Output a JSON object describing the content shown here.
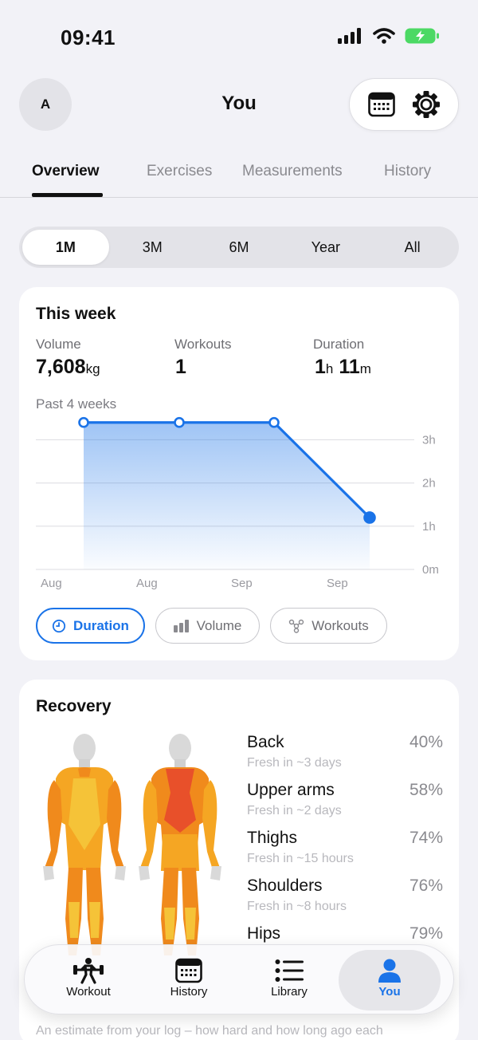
{
  "status": {
    "time": "09:41"
  },
  "header": {
    "avatar_initial": "A",
    "title": "You"
  },
  "tabs": [
    {
      "label": "Overview"
    },
    {
      "label": "Exercises"
    },
    {
      "label": "Measurements"
    },
    {
      "label": "History"
    }
  ],
  "ranges": [
    {
      "label": "1M"
    },
    {
      "label": "3M"
    },
    {
      "label": "6M"
    },
    {
      "label": "Year"
    },
    {
      "label": "All"
    }
  ],
  "this_week": {
    "title": "This week",
    "volume_label": "Volume",
    "volume_value": "7,608",
    "volume_unit": "kg",
    "workouts_label": "Workouts",
    "workouts_value": "1",
    "duration_label": "Duration",
    "duration_hours": "1",
    "duration_hours_unit": "h",
    "duration_minutes": "11",
    "duration_minutes_unit": "m",
    "chart_caption": "Past 4 weeks"
  },
  "chart_data": {
    "type": "area",
    "categories": [
      "Aug",
      "Aug",
      "Sep",
      "Sep"
    ],
    "values": [
      3.4,
      3.4,
      3.4,
      1.2
    ],
    "ylim": [
      0,
      3
    ],
    "y_ticks": [
      "3h",
      "2h",
      "1h",
      "0m"
    ],
    "grid": true,
    "color": "#1a73e8"
  },
  "metric_pills": [
    {
      "label": "Duration"
    },
    {
      "label": "Volume"
    },
    {
      "label": "Workouts"
    }
  ],
  "recovery": {
    "title": "Recovery",
    "items": [
      {
        "name": "Back",
        "sub": "Fresh in ~3 days",
        "pct": "40%"
      },
      {
        "name": "Upper arms",
        "sub": "Fresh in ~2 days",
        "pct": "58%"
      },
      {
        "name": "Thighs",
        "sub": "Fresh in ~15 hours",
        "pct": "74%"
      },
      {
        "name": "Shoulders",
        "sub": "Fresh in ~8 hours",
        "pct": "76%"
      },
      {
        "name": "Hips",
        "pct": "79%"
      }
    ],
    "footnote": "An estimate from your log – how hard and how long ago each"
  },
  "nav": [
    {
      "label": "Workout"
    },
    {
      "label": "History"
    },
    {
      "label": "Library"
    },
    {
      "label": "You"
    }
  ],
  "colors": {
    "accent": "#1a73e8",
    "fatigue_high": "#e8502a",
    "fatigue_mid": "#f08a1c",
    "fatigue_low": "#f5c338"
  }
}
